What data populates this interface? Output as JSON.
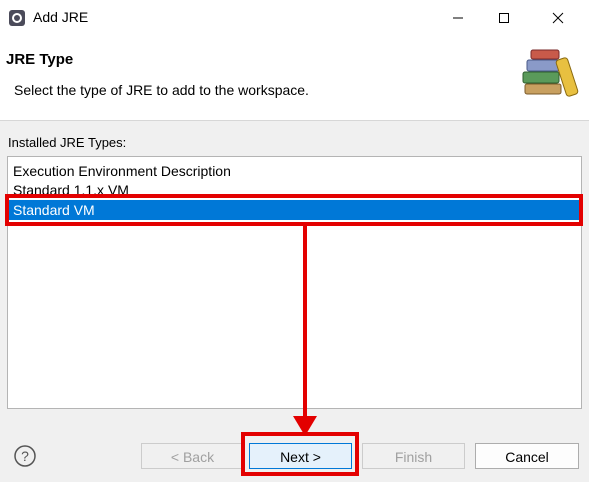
{
  "window": {
    "title": "Add JRE",
    "icon": "eclipse-icon",
    "controls": [
      "minimize-icon",
      "maximize-icon",
      "close-icon"
    ]
  },
  "header": {
    "title": "JRE Type",
    "description": "Select the type of JRE to add to the workspace.",
    "image": "jre-books-icon"
  },
  "content": {
    "list_label": "Installed JRE Types:",
    "items": [
      {
        "label": "Execution Environment Description",
        "selected": false
      },
      {
        "label": "Standard 1.1.x VM",
        "selected": false
      },
      {
        "label": "Standard VM",
        "selected": true
      }
    ]
  },
  "footer": {
    "help_icon": "help-icon",
    "back_label": "< Back",
    "next_label": "Next >",
    "finish_label": "Finish",
    "cancel_label": "Cancel"
  },
  "colors": {
    "selection": "#0078d7",
    "annotation": "#e30000"
  }
}
